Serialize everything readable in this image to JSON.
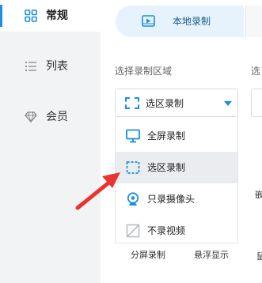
{
  "sidebar": {
    "items": [
      {
        "label": "常规",
        "icon": "grid-icon",
        "active": true
      },
      {
        "label": "列表",
        "icon": "list-icon",
        "active": false
      },
      {
        "label": "会员",
        "icon": "diamond-icon",
        "active": false
      }
    ]
  },
  "tabs": {
    "active_label": "本地录制"
  },
  "section": {
    "region_label": "选择录制区域",
    "right_label_partial": "选"
  },
  "select": {
    "value": "选区录制"
  },
  "dropdown": {
    "options": [
      {
        "label": "全屏录制",
        "icon": "monitor-icon"
      },
      {
        "label": "选区录制",
        "icon": "dashed-region-icon",
        "hover": true
      },
      {
        "label": "只录摄像头",
        "icon": "webcam-icon"
      },
      {
        "label": "不录视频",
        "icon": "no-video-icon"
      }
    ]
  },
  "bottom": {
    "left_label": "分屏录制",
    "middle_label": "悬浮显示",
    "side_glyph": "嵌",
    "right_glyph": "鼠"
  },
  "colors": {
    "accent": "#1a8fe3",
    "arrow": "#e8352f",
    "sidebar_bg": "#f2f3f5"
  }
}
